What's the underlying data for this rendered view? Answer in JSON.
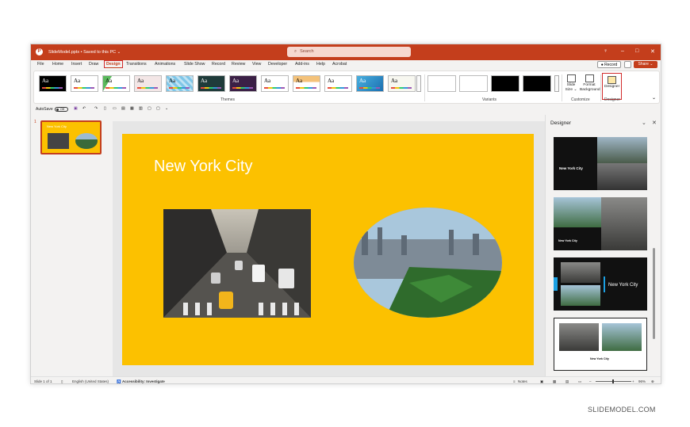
{
  "titlebar": {
    "file": "SlideModel.pptx • Saved to this PC ⌄",
    "search_placeholder": "Search"
  },
  "menu": [
    "File",
    "Home",
    "Insert",
    "Draw",
    "Design",
    "Transitions",
    "Animations",
    "Slide Show",
    "Record",
    "Review",
    "View",
    "Developer",
    "Add-ins",
    "Help",
    "Acrobat"
  ],
  "menu_active": "Design",
  "buttons": {
    "record": "● Record",
    "share": "Share ⌄"
  },
  "ribbon": {
    "themes_label": "Themes",
    "variants_label": "Variants",
    "customize_label": "Customize",
    "designer_group_label": "Designer",
    "theme_glyph": "Aa",
    "slide_size": "Slide Size ⌄",
    "format_background": "Format Background",
    "designer_button": "Designer"
  },
  "qat": {
    "autosave": "AutoSave",
    "toggle": "Off"
  },
  "slide": {
    "number": "1",
    "title": "New York City"
  },
  "designer_pane": {
    "title": "Designer",
    "card_text": "New York City"
  },
  "status": {
    "slide": "Slide 1 of 1",
    "language": "English (United States)",
    "accessibility": "Accessibility: Investigate",
    "notes": "Notes",
    "zoom": "96%"
  },
  "watermark": "SLIDEMODEL.COM",
  "colors": {
    "accent": "#c43e1c",
    "slide_bg": "#fcc100"
  }
}
